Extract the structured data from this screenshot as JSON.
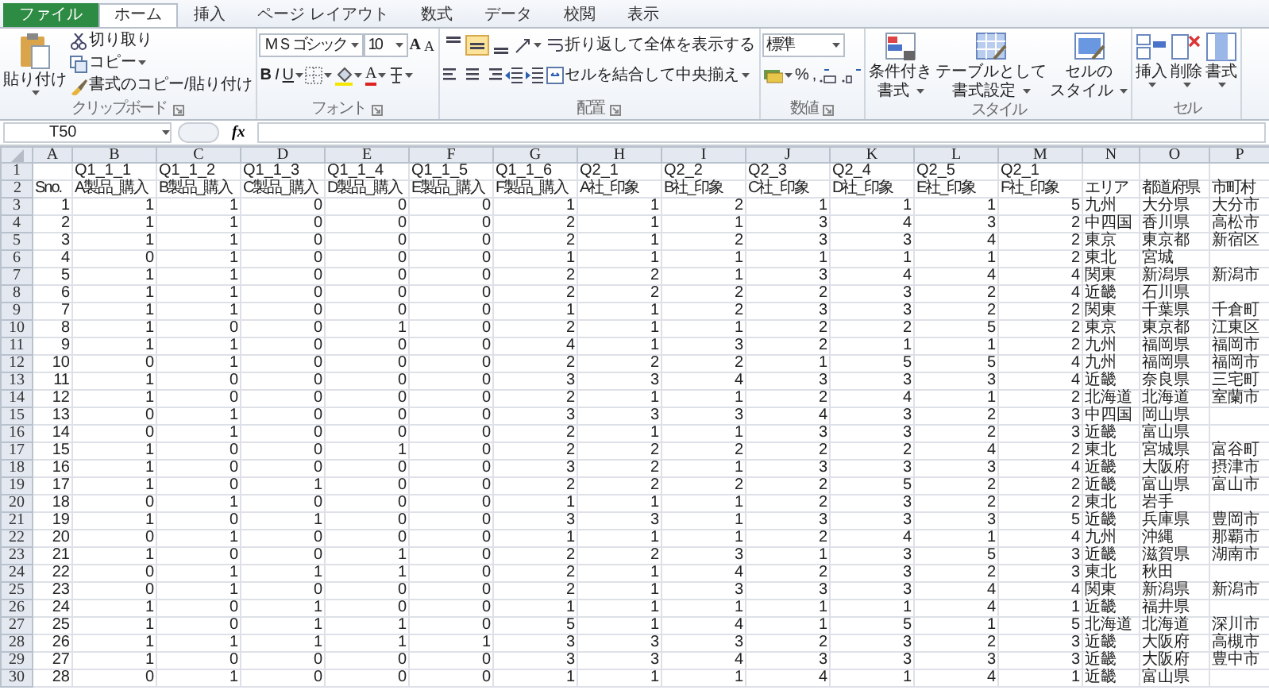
{
  "tabs": [
    {
      "label": "ファイル",
      "kind": "file",
      "selected": false
    },
    {
      "label": "ホーム",
      "kind": "tab",
      "selected": true
    },
    {
      "label": "挿入",
      "kind": "tab",
      "selected": false
    },
    {
      "label": "ページ レイアウト",
      "kind": "tab",
      "selected": false
    },
    {
      "label": "数式",
      "kind": "tab",
      "selected": false
    },
    {
      "label": "データ",
      "kind": "tab",
      "selected": false
    },
    {
      "label": "校閲",
      "kind": "tab",
      "selected": false
    },
    {
      "label": "表示",
      "kind": "tab",
      "selected": false
    }
  ],
  "ribbon": {
    "clipboard": {
      "label": "クリップボード",
      "paste": "貼り付け",
      "cut": "切り取り",
      "copy": "コピー",
      "format_painter": "書式のコピー/貼り付け"
    },
    "font": {
      "label": "フォント",
      "font_name": "ＭＳ ゴシック",
      "font_size": "10",
      "grow": "A",
      "shrink": "A",
      "bold": "B",
      "italic": "I",
      "underline": "U",
      "font_color": "A"
    },
    "alignment": {
      "label": "配置",
      "vertical": [
        {
          "kind": "top",
          "selected": false
        },
        {
          "kind": "middle",
          "selected": true
        },
        {
          "kind": "bottom",
          "selected": false
        }
      ],
      "wrap_text": "折り返して全体を表示する",
      "merge_center": "セルを結合して中央揃え"
    },
    "number": {
      "label": "数値",
      "format": "標準",
      "percent": "%",
      "comma": ","
    },
    "styles": {
      "label": "スタイル",
      "buttons": [
        {
          "lines": [
            "条件付き",
            "書式"
          ]
        },
        {
          "lines": [
            "テーブルとして",
            "書式設定"
          ]
        },
        {
          "lines": [
            "セルの",
            "スタイル"
          ]
        }
      ]
    },
    "cells": {
      "label": "セル",
      "buttons": [
        "挿入",
        "削除",
        "書式"
      ]
    }
  },
  "formula_bar": {
    "name_box": "T50",
    "fx": "fx"
  },
  "sheet": {
    "columns": [
      {
        "letter": "A",
        "kind": "id"
      },
      {
        "letter": "B",
        "kind": "answer"
      },
      {
        "letter": "C",
        "kind": "answer"
      },
      {
        "letter": "D",
        "kind": "answer"
      },
      {
        "letter": "E",
        "kind": "answer"
      },
      {
        "letter": "F",
        "kind": "answer"
      },
      {
        "letter": "G",
        "kind": "answer"
      },
      {
        "letter": "H",
        "kind": "answer"
      },
      {
        "letter": "I",
        "kind": "answer"
      },
      {
        "letter": "J",
        "kind": "answer"
      },
      {
        "letter": "K",
        "kind": "answer"
      },
      {
        "letter": "L",
        "kind": "answer"
      },
      {
        "letter": "M",
        "kind": "answer"
      },
      {
        "letter": "N",
        "kind": "text"
      },
      {
        "letter": "O",
        "kind": "text"
      },
      {
        "letter": "P",
        "kind": "text"
      }
    ],
    "rows": [
      {
        "number": "1",
        "kind": "header",
        "cells": [
          "",
          "Q1_1_1",
          "Q1_1_2",
          "Q1_1_3",
          "Q1_1_4",
          "Q1_1_5",
          "Q1_1_6",
          "Q2_1",
          "Q2_2",
          "Q2_3",
          "Q2_4",
          "Q2_5",
          "Q2_1"
        ]
      },
      {
        "number": "2",
        "kind": "header",
        "cells": [
          "Sno.",
          "A製品_購入",
          "B製品_購入",
          "C製品_購入",
          "D製品_購入",
          "E製品_購入",
          "F製品_購入",
          "A社_印象",
          "B社_印象",
          "C社_印象",
          "D社_印象",
          "E社_印象",
          "F社_印象",
          "エリア",
          "都道府県",
          "市町村"
        ]
      },
      {
        "number": "3",
        "kind": "data",
        "cells": [
          "1",
          "1",
          "1",
          "0",
          "0",
          "0",
          "1",
          "1",
          "2",
          "1",
          "1",
          "1",
          "5",
          "九州",
          "大分県",
          "大分市"
        ]
      },
      {
        "number": "4",
        "kind": "data",
        "cells": [
          "2",
          "1",
          "1",
          "0",
          "0",
          "0",
          "2",
          "1",
          "1",
          "3",
          "4",
          "3",
          "2",
          "中四国",
          "香川県",
          "高松市"
        ]
      },
      {
        "number": "5",
        "kind": "data",
        "cells": [
          "3",
          "1",
          "1",
          "0",
          "0",
          "0",
          "2",
          "1",
          "2",
          "3",
          "3",
          "4",
          "2",
          "東京",
          "東京都",
          "新宿区"
        ]
      },
      {
        "number": "6",
        "kind": "data",
        "cells": [
          "4",
          "0",
          "1",
          "0",
          "0",
          "0",
          "1",
          "1",
          "1",
          "1",
          "1",
          "1",
          "2",
          "東北",
          "宮城"
        ]
      },
      {
        "number": "7",
        "kind": "data",
        "cells": [
          "5",
          "1",
          "1",
          "0",
          "0",
          "0",
          "2",
          "2",
          "1",
          "3",
          "4",
          "4",
          "4",
          "関東",
          "新潟県",
          "新潟市"
        ]
      },
      {
        "number": "8",
        "kind": "data",
        "cells": [
          "6",
          "1",
          "1",
          "0",
          "0",
          "0",
          "2",
          "2",
          "2",
          "2",
          "3",
          "2",
          "4",
          "近畿",
          "石川県"
        ]
      },
      {
        "number": "9",
        "kind": "data",
        "cells": [
          "7",
          "1",
          "1",
          "0",
          "0",
          "0",
          "1",
          "1",
          "2",
          "3",
          "3",
          "2",
          "2",
          "関東",
          "千葉県",
          "千倉町"
        ]
      },
      {
        "number": "10",
        "kind": "data",
        "cells": [
          "8",
          "1",
          "0",
          "0",
          "1",
          "0",
          "2",
          "1",
          "1",
          "2",
          "2",
          "5",
          "2",
          "東京",
          "東京都",
          "江東区"
        ]
      },
      {
        "number": "11",
        "kind": "data",
        "cells": [
          "9",
          "1",
          "1",
          "0",
          "0",
          "0",
          "4",
          "1",
          "3",
          "2",
          "1",
          "1",
          "2",
          "九州",
          "福岡県",
          "福岡市"
        ]
      },
      {
        "number": "12",
        "kind": "data",
        "cells": [
          "10",
          "0",
          "1",
          "0",
          "0",
          "0",
          "2",
          "2",
          "2",
          "1",
          "5",
          "5",
          "4",
          "九州",
          "福岡県",
          "福岡市"
        ]
      },
      {
        "number": "13",
        "kind": "data",
        "cells": [
          "11",
          "1",
          "0",
          "0",
          "0",
          "0",
          "3",
          "3",
          "4",
          "3",
          "3",
          "3",
          "4",
          "近畿",
          "奈良県",
          "三宅町"
        ]
      },
      {
        "number": "14",
        "kind": "data",
        "cells": [
          "12",
          "1",
          "0",
          "0",
          "0",
          "0",
          "2",
          "1",
          "1",
          "2",
          "4",
          "1",
          "2",
          "北海道",
          "北海道",
          "室蘭市"
        ]
      },
      {
        "number": "15",
        "kind": "data",
        "cells": [
          "13",
          "0",
          "1",
          "0",
          "0",
          "0",
          "3",
          "3",
          "3",
          "4",
          "3",
          "2",
          "3",
          "中四国",
          "岡山県"
        ]
      },
      {
        "number": "16",
        "kind": "data",
        "cells": [
          "14",
          "0",
          "1",
          "0",
          "0",
          "0",
          "2",
          "1",
          "1",
          "3",
          "3",
          "2",
          "3",
          "近畿",
          "富山県"
        ]
      },
      {
        "number": "17",
        "kind": "data",
        "cells": [
          "15",
          "1",
          "0",
          "0",
          "1",
          "0",
          "2",
          "2",
          "2",
          "2",
          "2",
          "4",
          "2",
          "東北",
          "宮城県",
          "富谷町"
        ]
      },
      {
        "number": "18",
        "kind": "data",
        "cells": [
          "16",
          "1",
          "0",
          "0",
          "0",
          "0",
          "3",
          "2",
          "1",
          "3",
          "3",
          "3",
          "4",
          "近畿",
          "大阪府",
          "摂津市"
        ]
      },
      {
        "number": "19",
        "kind": "data",
        "cells": [
          "17",
          "1",
          "0",
          "1",
          "0",
          "0",
          "2",
          "2",
          "2",
          "2",
          "5",
          "2",
          "2",
          "近畿",
          "富山県",
          "富山市"
        ]
      },
      {
        "number": "20",
        "kind": "data",
        "cells": [
          "18",
          "0",
          "1",
          "0",
          "0",
          "0",
          "1",
          "1",
          "1",
          "2",
          "3",
          "2",
          "2",
          "東北",
          "岩手"
        ]
      },
      {
        "number": "21",
        "kind": "data",
        "cells": [
          "19",
          "1",
          "0",
          "1",
          "0",
          "0",
          "3",
          "3",
          "1",
          "3",
          "3",
          "3",
          "5",
          "近畿",
          "兵庫県",
          "豊岡市"
        ]
      },
      {
        "number": "22",
        "kind": "data",
        "cells": [
          "20",
          "0",
          "1",
          "0",
          "0",
          "0",
          "1",
          "1",
          "1",
          "2",
          "4",
          "1",
          "4",
          "九州",
          "沖縄",
          "那覇市"
        ]
      },
      {
        "number": "23",
        "kind": "data",
        "cells": [
          "21",
          "1",
          "0",
          "0",
          "1",
          "0",
          "2",
          "2",
          "3",
          "1",
          "3",
          "5",
          "3",
          "近畿",
          "滋賀県",
          "湖南市"
        ]
      },
      {
        "number": "24",
        "kind": "data",
        "cells": [
          "22",
          "0",
          "1",
          "1",
          "1",
          "0",
          "2",
          "1",
          "4",
          "2",
          "3",
          "2",
          "3",
          "東北",
          "秋田"
        ]
      },
      {
        "number": "25",
        "kind": "data",
        "cells": [
          "23",
          "0",
          "1",
          "0",
          "0",
          "0",
          "2",
          "1",
          "3",
          "3",
          "3",
          "4",
          "4",
          "関東",
          "新潟県",
          "新潟市"
        ]
      },
      {
        "number": "26",
        "kind": "data",
        "cells": [
          "24",
          "1",
          "0",
          "1",
          "0",
          "0",
          "1",
          "1",
          "1",
          "1",
          "1",
          "4",
          "1",
          "近畿",
          "福井県"
        ]
      },
      {
        "number": "27",
        "kind": "data",
        "cells": [
          "25",
          "1",
          "0",
          "1",
          "1",
          "0",
          "5",
          "1",
          "4",
          "1",
          "5",
          "1",
          "5",
          "北海道",
          "北海道",
          "深川市"
        ]
      },
      {
        "number": "28",
        "kind": "data",
        "cells": [
          "26",
          "1",
          "1",
          "1",
          "1",
          "1",
          "3",
          "3",
          "3",
          "2",
          "3",
          "2",
          "3",
          "近畿",
          "大阪府",
          "高槻市"
        ]
      },
      {
        "number": "29",
        "kind": "data",
        "cells": [
          "27",
          "1",
          "0",
          "0",
          "0",
          "0",
          "3",
          "3",
          "4",
          "3",
          "3",
          "3",
          "3",
          "近畿",
          "大阪府",
          "豊中市"
        ]
      },
      {
        "number": "30",
        "kind": "data",
        "cells": [
          "28",
          "0",
          "1",
          "0",
          "0",
          "0",
          "1",
          "1",
          "1",
          "4",
          "1",
          "4",
          "1",
          "近畿",
          "富山県"
        ]
      }
    ]
  }
}
